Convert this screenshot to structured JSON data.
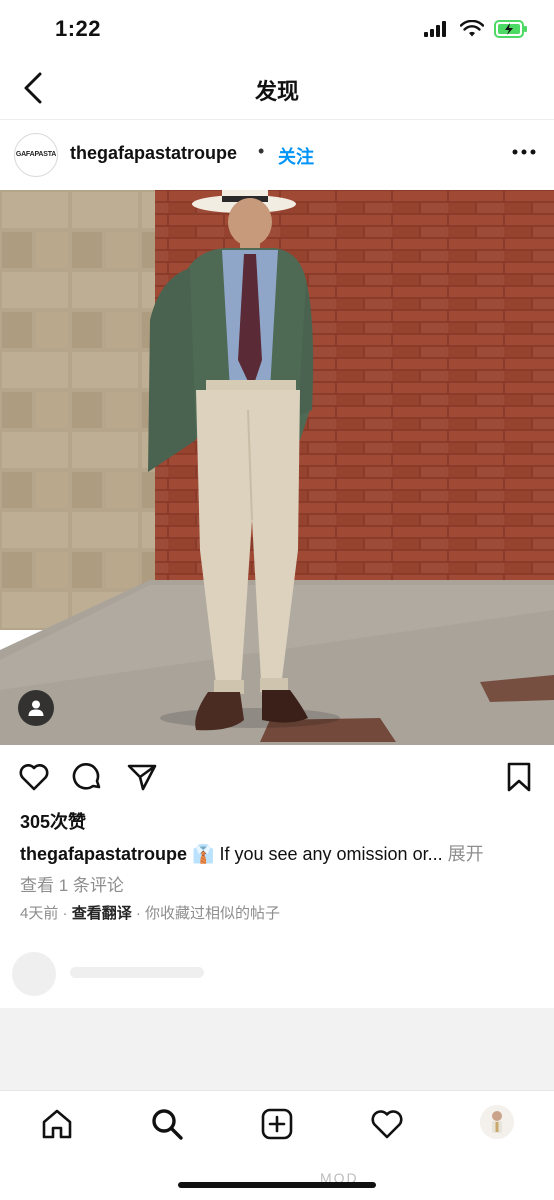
{
  "status_bar": {
    "time": "1:22"
  },
  "nav": {
    "title": "发现"
  },
  "post": {
    "username": "thegafapastatroupe",
    "avatar_text": "GAFAPASTA",
    "follow_label": "关注",
    "likes": "305次赞",
    "caption_user": "thegafapastatroupe",
    "caption_emoji": "👔",
    "caption_text": " If you see any omission or...",
    "caption_more": " 展开",
    "view_comments": "查看 1 条评论",
    "time_ago": "4天前",
    "translate_label": "查看翻译",
    "similar_note": "你收藏过相似的帖子"
  },
  "watermark": "MOD",
  "icons": {
    "back": "chevron-left-icon",
    "more": "more-horizontal-icon",
    "like": "heart-icon",
    "comment": "comment-icon",
    "share": "send-icon",
    "save": "bookmark-icon",
    "home": "home-icon",
    "search": "search-icon",
    "create": "plus-square-icon",
    "activity": "heart-icon",
    "user_tag": "person-icon"
  },
  "colors": {
    "follow_blue": "#0095f6",
    "meta_gray": "#8e8e8e",
    "battery_green": "#4cd964"
  }
}
